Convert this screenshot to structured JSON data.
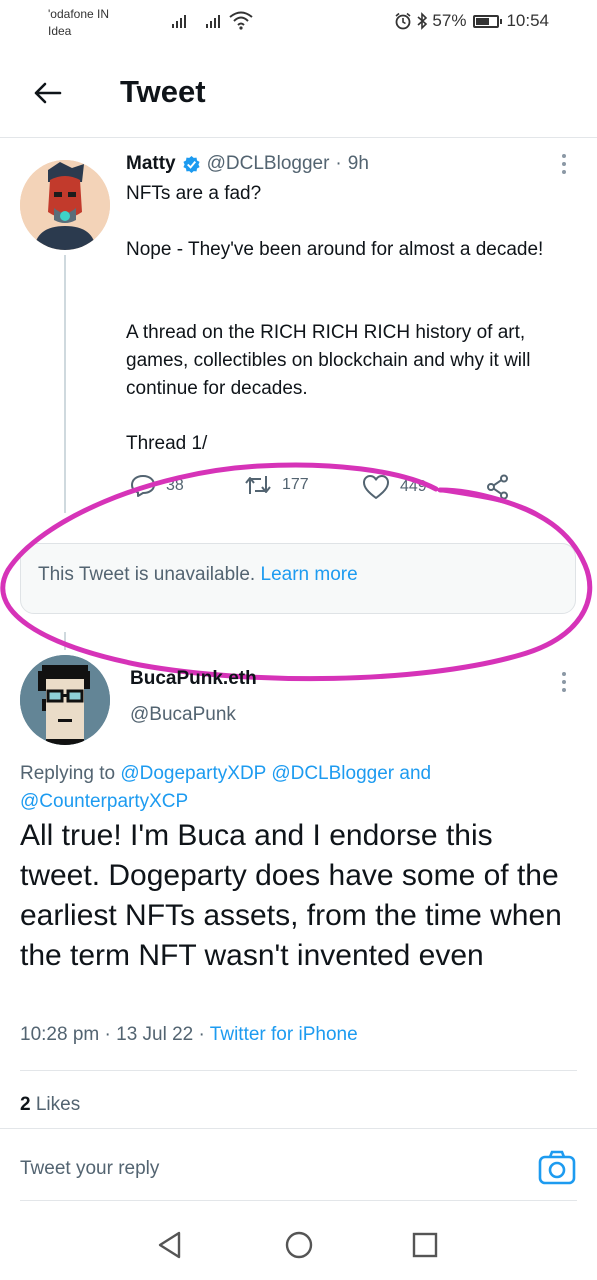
{
  "status_bar": {
    "carrier_line1": "'odafone IN",
    "carrier_line2": "Idea",
    "battery_percent": "57%",
    "battery_level": 0.57,
    "time": "10:54"
  },
  "header": {
    "title": "Tweet"
  },
  "tweet": {
    "author_name": "Matty",
    "handle": "@DCLBlogger",
    "separator": "·",
    "time_ago": "9h",
    "lines": [
      "NFTs are a fad?",
      "Nope - They've been around for almost a decade!",
      "A thread on the RICH RICH RICH history of art, games, collectibles on blockchain and why it will continue for decades.",
      "Thread 1/"
    ],
    "replies": "38",
    "retweets": "177",
    "likes": "449"
  },
  "unavailable": {
    "text": "This Tweet is unavailable.",
    "link": "Learn more"
  },
  "reply": {
    "author_name": "BucaPunk.eth",
    "handle": "@BucaPunk",
    "replying_prefix": "Replying to",
    "mention_1": "@DogepartyXDP",
    "mention_2": "@DCLBlogger",
    "conjunction": "and",
    "mention_3": "@CounterpartyXCP",
    "text": "All true! I'm Buca and I endorse this tweet. Dogeparty does have some of the earliest NFTs assets, from the time when the term NFT wasn't invented even",
    "time": "10:28 pm",
    "date": "13 Jul 22",
    "separator": "·",
    "client": "Twitter for iPhone",
    "likes_count": "2",
    "likes_label": "Likes"
  },
  "compose": {
    "placeholder": "Tweet your reply"
  },
  "colors": {
    "accent": "#1d9bf0",
    "annotation": "#d633b8",
    "secondary_text": "#536471"
  }
}
